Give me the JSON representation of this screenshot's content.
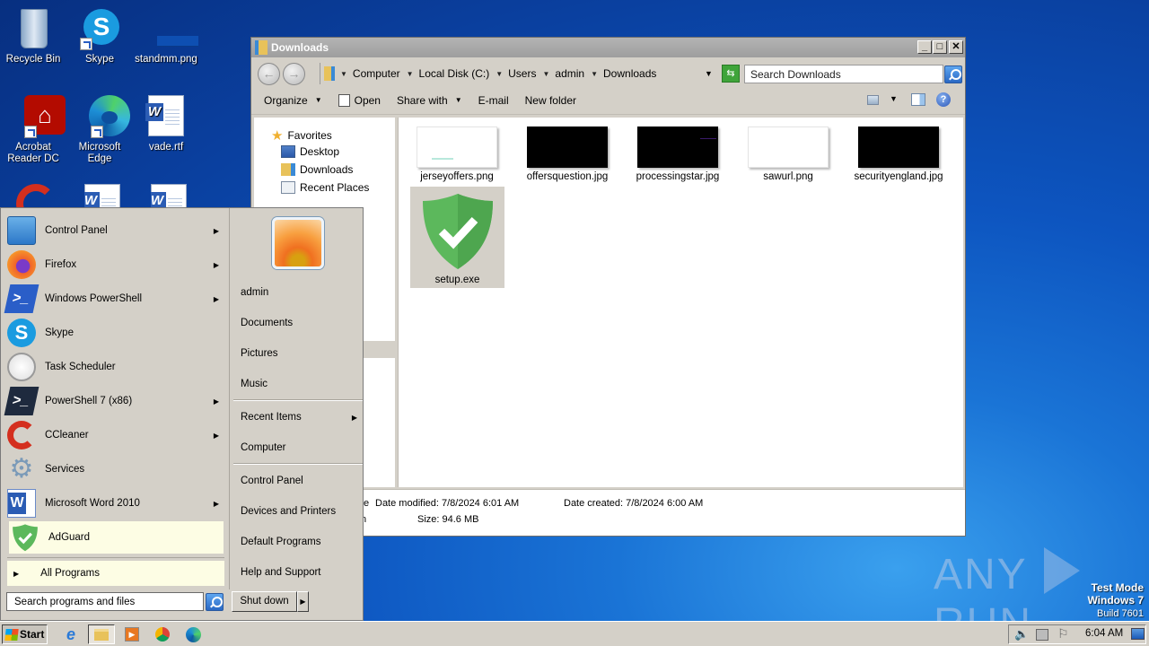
{
  "desktop": {
    "icons": [
      {
        "label": "Recycle Bin",
        "icon": "recycle-bin-icon"
      },
      {
        "label": "Skype",
        "icon": "skype-icon"
      },
      {
        "label": "standmm.png",
        "icon": "image-file-icon"
      },
      {
        "label": "Acrobat Reader DC",
        "label_line1": "Acrobat",
        "label_line2": "Reader DC",
        "icon": "acrobat-icon"
      },
      {
        "label": "Microsoft Edge",
        "icon": "edge-icon"
      },
      {
        "label": "vade.rtf",
        "icon": "word-doc-icon"
      }
    ],
    "watermark": {
      "brand_left": "ANY",
      "brand_right": "RUN",
      "mode": "Test Mode",
      "os": "Windows 7",
      "build": "Build 7601"
    }
  },
  "explorer": {
    "title": "Downloads",
    "breadcrumb": [
      "Computer",
      "Local Disk (C:)",
      "Users",
      "admin",
      "Downloads"
    ],
    "search_placeholder": "Search Downloads",
    "toolbar": {
      "organize": "Organize",
      "open": "Open",
      "share_with": "Share with",
      "email": "E-mail",
      "new_folder": "New folder"
    },
    "nav": {
      "favorites": "Favorites",
      "items": [
        "Desktop",
        "Downloads",
        "Recent Places"
      ]
    },
    "files": [
      {
        "name": "jerseyoffers.png",
        "thumb": "#ffffff"
      },
      {
        "name": "offersquestion.jpg",
        "thumb": "#000000"
      },
      {
        "name": "processingstar.jpg",
        "thumb": "#000000"
      },
      {
        "name": "sawurl.png",
        "thumb": "#ffffff"
      },
      {
        "name": "securityengland.jpg",
        "thumb": "#000000"
      },
      {
        "name": "setup.exe",
        "thumb": "adguard",
        "selected": true
      }
    ],
    "details": {
      "date_modified": "Date modified: 7/8/2024 6:01 AM",
      "date_created": "Date created: 7/8/2024 6:00 AM",
      "size": "Size: 94.6 MB",
      "clipped1": "te",
      "clipped2": "n"
    }
  },
  "start_menu": {
    "programs": [
      {
        "label": "Control Panel",
        "submenu": true
      },
      {
        "label": "Firefox",
        "submenu": true
      },
      {
        "label": "Windows PowerShell",
        "submenu": true
      },
      {
        "label": "Skype",
        "submenu": false
      },
      {
        "label": "Task Scheduler",
        "submenu": false
      },
      {
        "label": "PowerShell 7 (x86)",
        "submenu": true
      },
      {
        "label": "CCleaner",
        "submenu": true
      },
      {
        "label": "Services",
        "submenu": false
      },
      {
        "label": "Microsoft Word 2010",
        "submenu": true
      },
      {
        "label": "AdGuard",
        "submenu": false,
        "highlighted": true
      }
    ],
    "all_programs": "All Programs",
    "search_placeholder": "Search programs and files",
    "right": {
      "user": "admin",
      "documents": "Documents",
      "pictures": "Pictures",
      "music": "Music",
      "recent_items": "Recent Items",
      "computer": "Computer",
      "control_panel": "Control Panel",
      "devices_printers": "Devices and Printers",
      "default_programs": "Default Programs",
      "help_support": "Help and Support"
    },
    "shutdown": "Shut down"
  },
  "taskbar": {
    "start": "Start",
    "clock": "6:04 AM",
    "pinned": [
      "internet-explorer",
      "windows-explorer",
      "media-player",
      "chrome",
      "edge"
    ]
  },
  "colors": {
    "adguard_green": "#5cb85c",
    "highlight": "#fdfde4",
    "desktop_blue": "#0d55c0"
  }
}
